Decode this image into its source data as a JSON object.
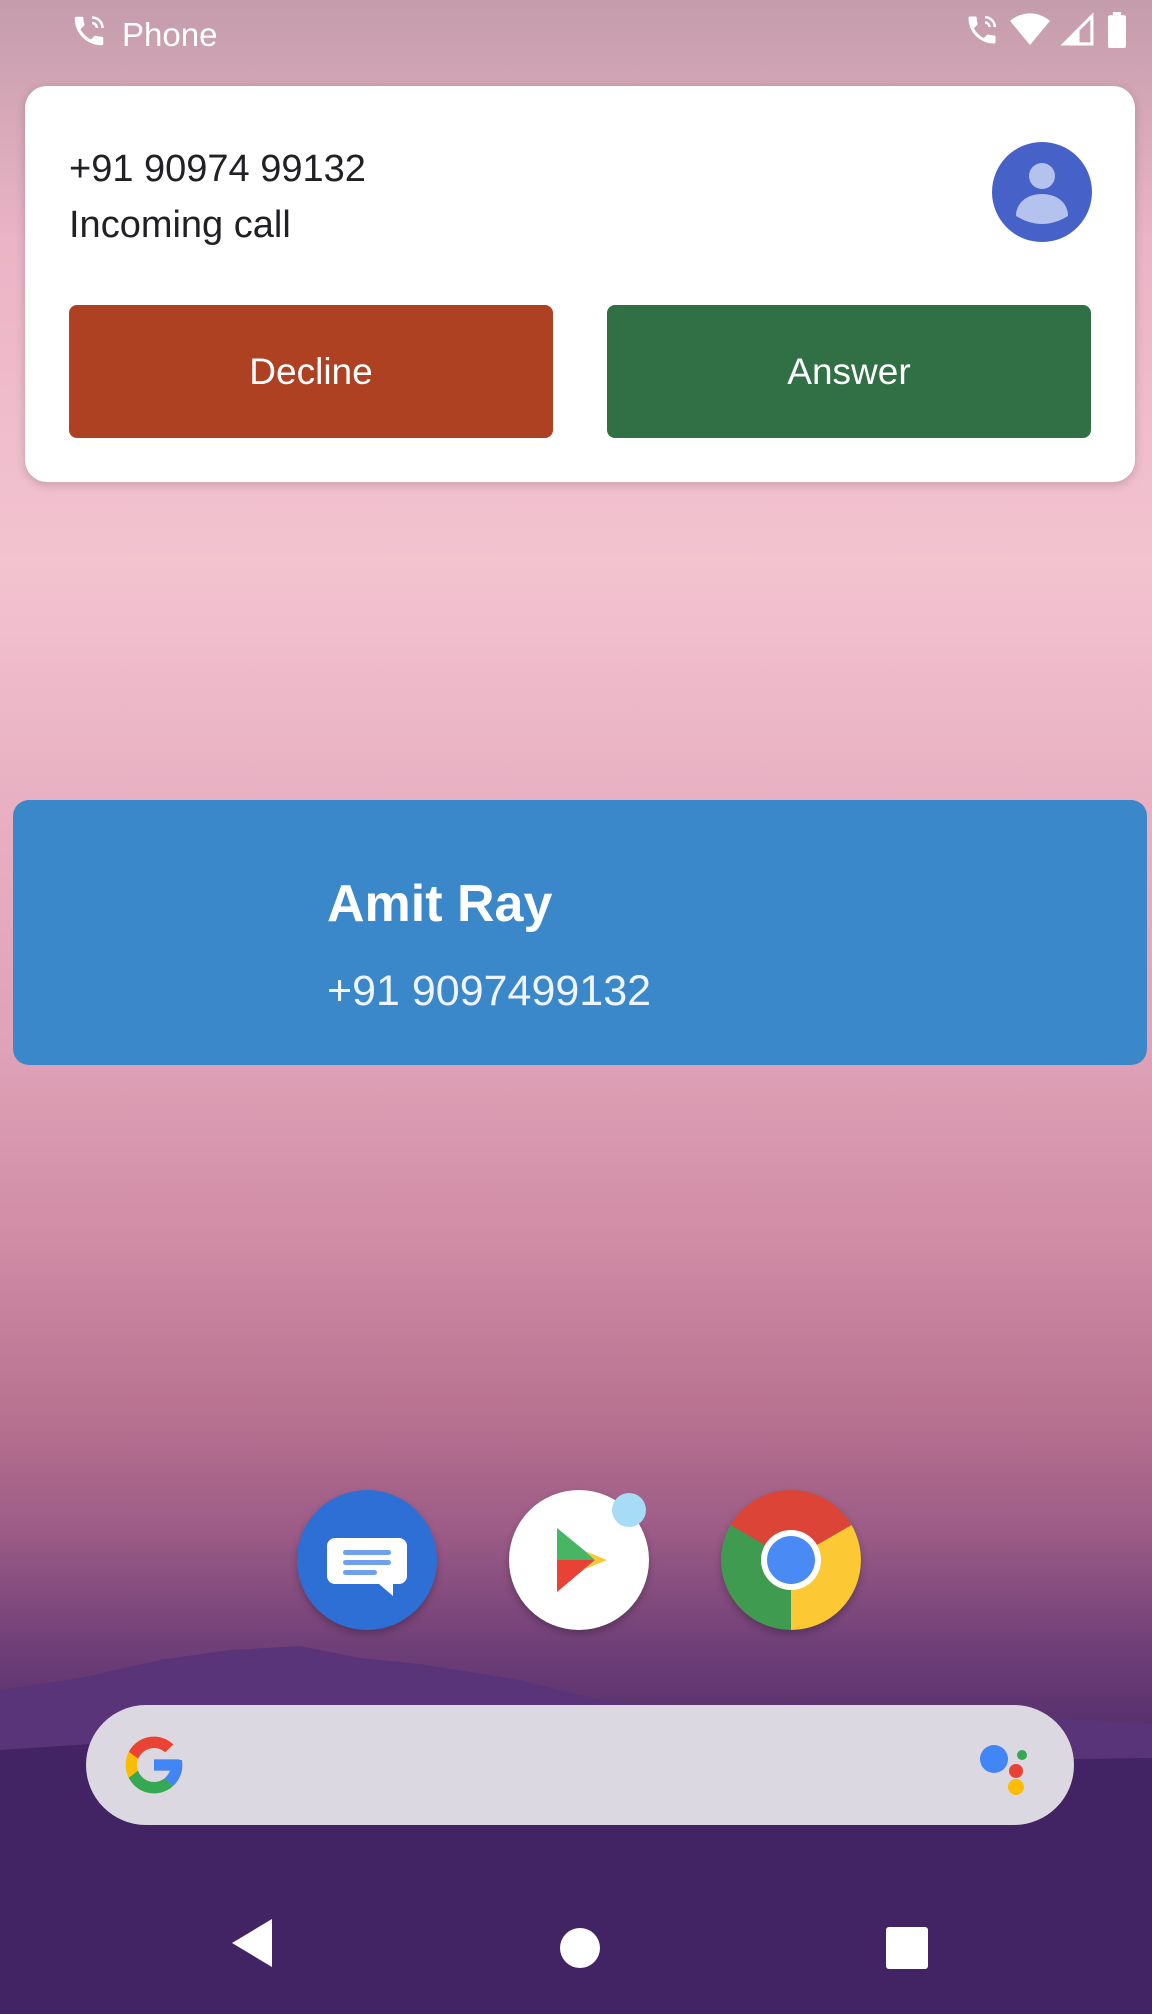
{
  "status_bar": {
    "app_label": "Phone",
    "icons": [
      "phone-icon",
      "call-active-icon",
      "wifi-icon",
      "signal-icon",
      "battery-icon"
    ]
  },
  "incoming_call": {
    "number": "+91 90974 99132",
    "status": "Incoming call",
    "decline_label": "Decline",
    "answer_label": "Answer",
    "decline_color": "#ad4122",
    "answer_color": "#316f44",
    "avatar_color": "#4661c8"
  },
  "contact_banner": {
    "name": "Amit Ray",
    "number": "+91 9097499132",
    "color": "#3a88c9"
  },
  "dock": {
    "apps": [
      "messages-app",
      "play-store-app",
      "chrome-app"
    ]
  },
  "search_bar": {
    "icons": [
      "google-logo-icon",
      "assistant-icon"
    ]
  },
  "nav_bar": {
    "icons": [
      "back-icon",
      "home-icon",
      "recents-icon"
    ]
  }
}
